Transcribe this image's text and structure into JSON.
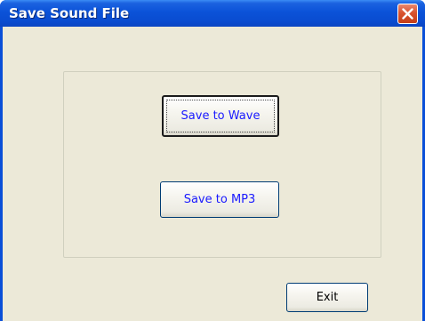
{
  "window": {
    "title": "Save Sound File"
  },
  "buttons": {
    "save_wave_label": "Save to Wave",
    "save_mp3_label": "Save to MP3",
    "exit_label": "Exit"
  },
  "colors": {
    "titlebar": "#0a4cd0",
    "client_background": "#ece9d8",
    "button_text_accent": "#1a1aff",
    "close_button": "#d9532f"
  },
  "icons": {
    "close": "close-icon"
  }
}
